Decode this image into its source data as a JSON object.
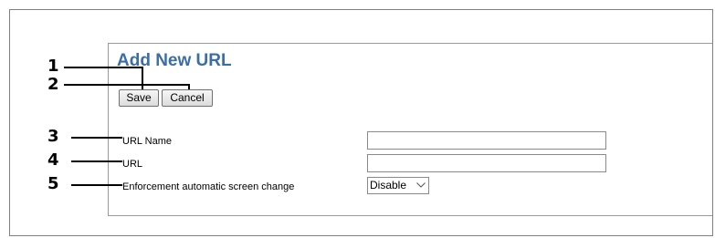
{
  "page": {
    "title": "Add New URL"
  },
  "buttons": {
    "save_label": "Save",
    "cancel_label": "Cancel"
  },
  "fields": {
    "url_name": {
      "label": "URL Name",
      "value": ""
    },
    "url": {
      "label": "URL",
      "value": ""
    },
    "enforcement": {
      "label": "Enforcement automatic screen change",
      "selected": "Disable",
      "icon": "chevron-down-icon"
    }
  },
  "callouts": {
    "c1": "1",
    "c2": "2",
    "c3": "3",
    "c4": "4",
    "c5": "5"
  }
}
